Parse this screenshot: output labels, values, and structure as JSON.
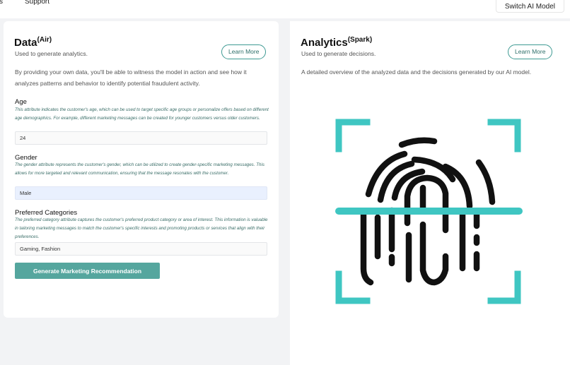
{
  "nav": {
    "partial_item": "s",
    "support": "Support",
    "switch_model": "Switch AI Model"
  },
  "data_card": {
    "title": "Data",
    "title_sup": "(Air)",
    "subtitle": "Used to generate analytics.",
    "learn_more": "Learn More",
    "description": "By providing your own data, you'll be able to witness the model in action and see how it analyzes patterns and behavior to identify potential fraudulent activity.",
    "fields": [
      {
        "label": "Age",
        "help": "This attribute indicates the customer's age, which can be used to target specific age groups or personalize offers based on different age demographics. For example, different marketing messages can be created for younger customers versus older customers.",
        "value": "24"
      },
      {
        "label": "Gender",
        "help": "The gender attribute represents the customer's gender, which can be utilized to create gender-specific marketing messages. This allows for more targeted and relevant communication, ensuring that the message resonates with the customer.",
        "value": "Male"
      },
      {
        "label": "Preferred Categories",
        "help": "The preferred category attribute captures the customer's preferred product category or area of interest. This information is valuable in tailoring marketing messages to match the customer's specific interests and promoting products or services that align with their preferences.",
        "value": "Gaming, Fashion"
      }
    ],
    "generate_button": "Generate Marketing Recommendation"
  },
  "analytics_card": {
    "title": "Analytics",
    "title_sup": "(Spark)",
    "subtitle": "Used to generate decisions.",
    "learn_more": "Learn More",
    "description": "A detailed overview of the analyzed data and the decisions generated by our AI model.",
    "illustration_icon": "fingerprint-scan-icon"
  },
  "colors": {
    "accent": "#3fc6c2",
    "button": "#55a69e",
    "border_accent": "#3e9a93"
  }
}
